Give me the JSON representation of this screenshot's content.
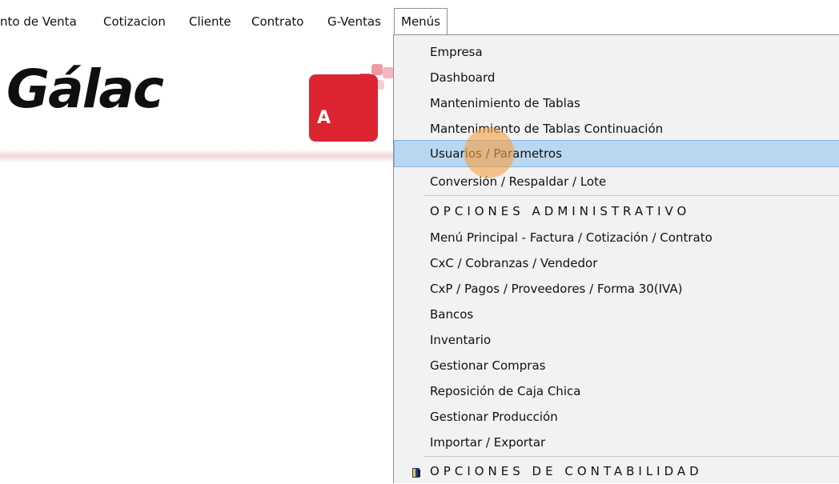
{
  "menubar": {
    "items": [
      {
        "label": "nto de Venta"
      },
      {
        "label": "Cotizacion"
      },
      {
        "label": "Cliente"
      },
      {
        "label": "Contrato"
      },
      {
        "label": "G-Ventas"
      },
      {
        "label": "Menús"
      }
    ]
  },
  "brand": {
    "logo_text": "Gálac",
    "app_icon_letter": "A"
  },
  "dropdown": {
    "items": [
      {
        "label": "Empresa"
      },
      {
        "label": "Dashboard"
      },
      {
        "label": "Mantenimiento de Tablas"
      },
      {
        "label": "Mantenimiento de Tablas Continuación"
      },
      {
        "label": "Usuarios / Parametros"
      },
      {
        "label": "Conversión / Respaldar / Lote"
      },
      {
        "label": "OPCIONES ADMINISTRATIVO"
      },
      {
        "label": "Menú Principal - Factura / Cotización / Contrato"
      },
      {
        "label": "CxC / Cobranzas / Vendedor"
      },
      {
        "label": "CxP / Pagos / Proveedores / Forma 30(IVA)"
      },
      {
        "label": "Bancos"
      },
      {
        "label": "Inventario"
      },
      {
        "label": "Gestionar Compras"
      },
      {
        "label": "Reposición de Caja Chica"
      },
      {
        "label": "Gestionar Producción"
      },
      {
        "label": "Importar / Exportar"
      },
      {
        "label": "OPCIONES DE CONTABILIDAD"
      }
    ],
    "selected": "Usuarios / Parametros"
  },
  "colors": {
    "selection_bg": "#b9d7f1",
    "brand_red": "#dd2532",
    "cursor_highlight": "#f5a142"
  }
}
